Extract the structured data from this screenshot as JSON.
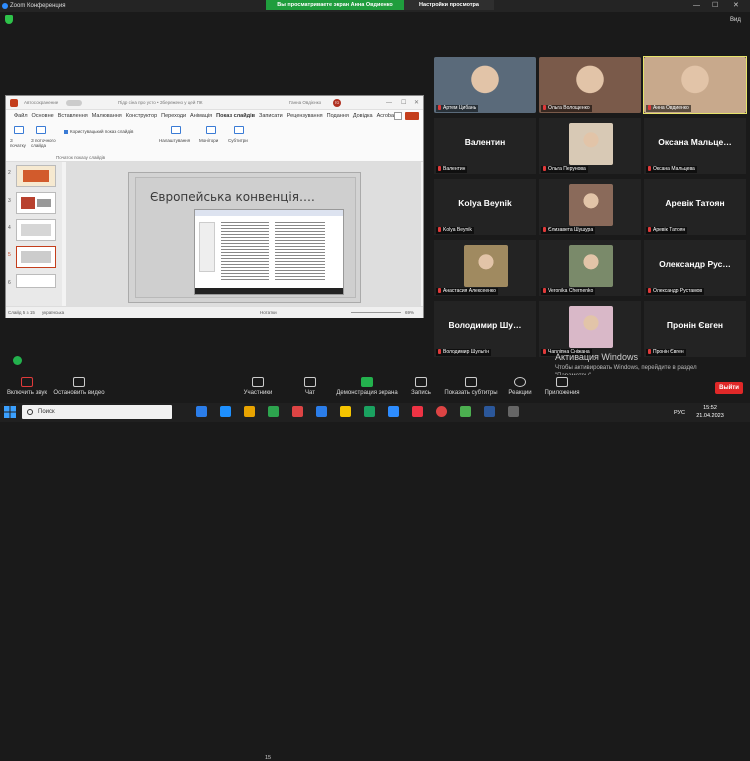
{
  "window": {
    "title": "Zoom Конференция"
  },
  "share_banner": "Вы просматриваете экран Анна Овдиенко",
  "view_options": "Настройки просмотра",
  "view_label": "Вид",
  "ppt": {
    "title_left": "Автосохранение",
    "title_center": "Підр сіна про усто • Збережено у цей ПК",
    "user": "Ганна Овдієнко",
    "user_initials": "ГО",
    "menu": [
      "Файл",
      "Основне",
      "Вставлення",
      "Малювання",
      "Конструктор",
      "Переходи",
      "Анімація",
      "Показ слайдів",
      "Записати",
      "Рецензування",
      "Подання",
      "Довідка",
      "Acrobat"
    ],
    "active_tab_index": 7,
    "ribbon": {
      "from_start": "З початку",
      "from_current": "З поточного слайда",
      "custom_show": "Користувацький показ слайдів",
      "setup": "Налаштування",
      "monitors": "Монітори",
      "subtitles": "Субтитри",
      "group_label": "Початок показу слайдів"
    },
    "thumb_numbers": [
      "2",
      "3",
      "4",
      "5",
      "6"
    ],
    "slide_title": "Європейська конвенція….",
    "status": {
      "slide": "Слайд 5 з 15",
      "lang": "українська",
      "notes": "Нотатки",
      "zoom": "69%"
    }
  },
  "tiles": [
    {
      "label": "Артем Цибань",
      "name": "",
      "photo": true,
      "color": "#5a6a7a"
    },
    {
      "label": "Ольга Волощенко",
      "name": "",
      "photo": true,
      "color": "#7a5a4a"
    },
    {
      "label": "Анна Овдиенко",
      "name": "",
      "photo": true,
      "color": "#c8a98c",
      "active": true
    },
    {
      "label": "Валентин",
      "name": "Валентин"
    },
    {
      "label": "Ольга Перунова",
      "name": "",
      "photo": true,
      "color": "#d8c9b5"
    },
    {
      "label": "Оксана Мальцева",
      "name": "Оксана Мальце…"
    },
    {
      "label": "Kolya Beynik",
      "name": "Kolya Beynik"
    },
    {
      "label": "Єлизавета Шушура",
      "name": "",
      "photo": true,
      "color": "#8a6a5a"
    },
    {
      "label": "Аревік Татоян",
      "name": "Аревік Татоян"
    },
    {
      "label": "Анастасия Алексеенко",
      "name": "",
      "photo": true,
      "color": "#a08a60"
    },
    {
      "label": "Veronika Chernenko",
      "name": "",
      "photo": true,
      "color": "#7a8a6a"
    },
    {
      "label": "Олександр Рустамов",
      "name": "Олександр Рус…"
    },
    {
      "label": "Володимир Шульгін",
      "name": "Володимир Шу…"
    },
    {
      "label": "Чапліпна Сніжана",
      "name": "",
      "photo": true,
      "color": "#d9b8c8"
    },
    {
      "label": "Пронін Євген",
      "name": "Пронін Євген"
    }
  ],
  "watermark": {
    "title": "Активация Windows",
    "text": "Чтобы активировать Windows, перейдите в раздел \"Параметры\"."
  },
  "toolbar": {
    "mic": "Включить звук",
    "video": "Остановить видео",
    "participants": "Участники",
    "participants_count": "15",
    "chat": "Чат",
    "share": "Демонстрация экрана",
    "record": "Запись",
    "captions": "Показать субтитры",
    "reactions": "Реакции",
    "apps": "Приложения",
    "leave": "Выйти"
  },
  "taskbar": {
    "search": "Поиск",
    "lang": "РУС",
    "time": "15:52",
    "date": "21.04.2023"
  },
  "colors": {
    "share_green": "#1f9d3d",
    "leave_red": "#e02828",
    "active_border": "#e6e36a",
    "ppt_accent": "#c43e1c"
  }
}
